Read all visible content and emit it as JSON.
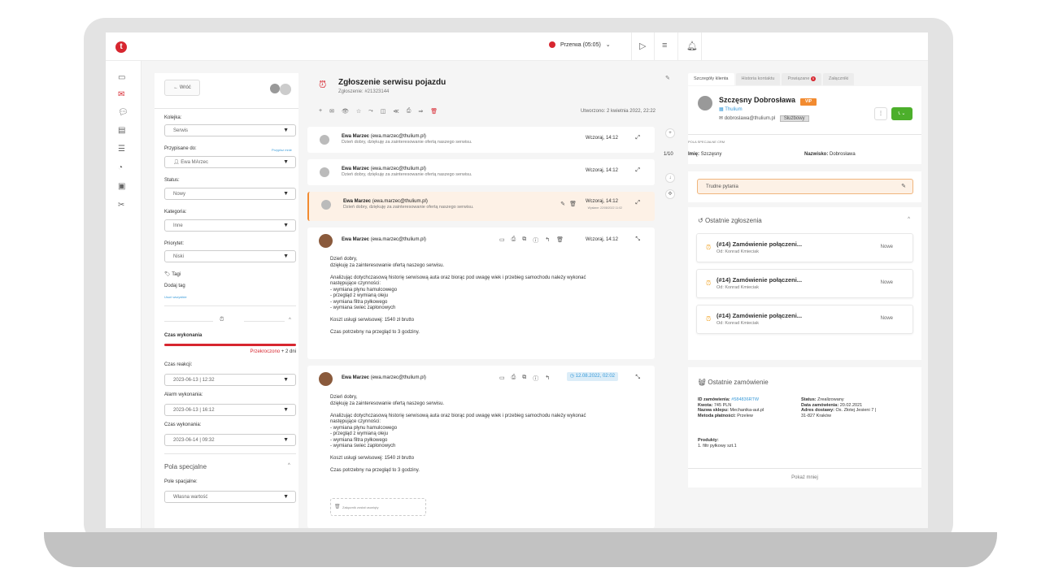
{
  "topbar": {
    "logo": "t",
    "break_label": "Przerwa (05:05)"
  },
  "left": {
    "back_label": "Wróć",
    "queue_label": "Kolejka:",
    "queue_value": "Serwis",
    "assigned_label": "Przypisane do:",
    "assign_me": "Przypisz mnie",
    "assigned_value": "Ewa MArzec",
    "status_label": "Status:",
    "status_value": "Nowy",
    "category_label": "Kategoria:",
    "category_value": "Inne",
    "priority_label": "Priorytet:",
    "priority_value": "Niski",
    "tags_label": "Tagi",
    "add_tag": "Dodaj tag",
    "remove_all": "Usuń wszystkie",
    "exec_time_label": "Czas wykonania",
    "exceeded": "Przekroczono",
    "exceeded_extra": "+ 2 dni",
    "reaction_label": "Czas reakcji:",
    "reaction_value": "2023-06-13 | 12:32",
    "alarm_label": "Alarm wykonania:",
    "alarm_value": "2023-06-13 | 16:12",
    "exec_label": "Czas wykonania:",
    "exec_value": "2023-06-14 | 09:32",
    "special_fields": "Pola specjalne",
    "special_field_label": "Pole spacjalne:",
    "special_field_value": "Własna wartość"
  },
  "center": {
    "title": "Zgłoszenie serwisu pojazdu",
    "subtitle": "Zgłoszenie: #21323144",
    "created": "Utworzono: 2 kwietnia 2022, 22:22",
    "messages": [
      {
        "name": "Ewa Marzec",
        "email": "(ewa.marzec@thulium.pl)",
        "snippet": "Dzień dobry,  dziękuję za zainteresowanie ofertą naszego serwisu.",
        "date": "Wczoraj, 14:12"
      },
      {
        "name": "Ewa Marzec",
        "email": "(ewa.marzec@thulium.pl)",
        "snippet": "Dzień dobry,  dziękuję za zainteresowanie ofertą naszego serwisu.",
        "date": "Wczoraj, 14:12"
      },
      {
        "name": "Ewa Marzec",
        "email": "(ewa.marzec@thulium.pl)",
        "snippet": "Dzień dobry,  dziękuję za zainteresowanie ofertą naszego serwisu.",
        "date": "Wczoraj, 14:12",
        "draft": "Wysłane: 22/08/2022 11:02"
      }
    ],
    "expanded1": {
      "name": "Ewa Marzec",
      "email": "(ewa.marzec@thulium.pl)",
      "date": "Wczoraj, 14:12",
      "body": "Dzień dobry,\ndziękuję za zainteresowanie ofertą naszego serwisu.\n\nAnalizując dotychczasową historię serwisową auta oraz biorąc pod uwagę wiek i przebieg samochodu należy wykonać\nnastępujące czynności:\n- wymiana płynu hamulcowego\n- przegląd z wymianą oleju\n- wymiana filtra pyłkowego\n- wymiana świec zapłonowych\n\nKoszt usługi serwisowej: 1540 zł brutto\n\nCzas potrzebny na przegląd to 3 godziny."
    },
    "expanded2": {
      "name": "Ewa Marzec",
      "email": "(ewa.marzec@thulium.pl)",
      "date": "12.08.2022, 02:02",
      "body": "Dzień dobry,\ndziękuję za zainteresowanie ofertą naszego serwisu.\n\nAnalizując dotychczasową historię serwisową auta oraz biorąc pod uwagę wiek i przebieg samochodu należy wykonać\nnastępujące czynności:\n- wymiana płynu hamulcowego\n- przegląd z wymianą oleju\n- wymiana filtra pyłkowego\n- wymiana świec zapłonowych\n\nKoszt usługi serwisowej: 1540 zł brutto\n\nCzas potrzebny na przegląd to 3 godziny.",
      "attachment": "Załącznik został usunięty"
    },
    "pager": "1/10"
  },
  "right": {
    "tabs": [
      "Szczegóły klienta",
      "Historia kontaktu",
      "Powiązane",
      "Załączniki"
    ],
    "related_count": "5",
    "customer_name": "Szczęsny Dobrosława",
    "vip": "VIP",
    "company": "Thulium",
    "email": "dobroslawa@thulium.pl",
    "email_tag": "Służbowy",
    "crm_header": "POLA SPECJALNE CRM",
    "first_name_label": "Imię:",
    "first_name": "Szczęsny",
    "last_name_label": "Nazwisko:",
    "last_name": "Dobrosława",
    "hard_questions": "Trudne pytania",
    "recent_tickets": "Ostatnie zgłoszenia",
    "tickets": [
      {
        "title": "(#14) Zamówienie połączeni...",
        "from": "Od: Konrad Kmieciak",
        "status": "Nowe"
      },
      {
        "title": "(#14) Zamówienie połączeni...",
        "from": "Od: Konrad Kmieciak",
        "status": "Nowe"
      },
      {
        "title": "(#14) Zamówienie połączeni...",
        "from": "Od: Konrad Kmieciak",
        "status": "Nowe"
      }
    ],
    "recent_orders": "Ostatnie zamówienie",
    "order": {
      "id_label": "ID zamówienia:",
      "id": "#584836RTW",
      "amount_label": "Kwota:",
      "amount": "745 PLN",
      "shop_label": "Nazwa sklepu:",
      "shop": "Mechanika-aut.pl",
      "payment_label": "Metoda płatności:",
      "payment": "Przelew",
      "status_label": "Status:",
      "status": "Zrealizowany",
      "date_label": "Data zamówienia:",
      "date": "20.02.2021",
      "address_label": "Adres dostawy:",
      "address1": "Os. Złotej Jesieni 7 |",
      "address2": "31-827 Kraków",
      "products_label": "Produkty:",
      "products": "1. filtr pyłkowy szt.1"
    },
    "show_less": "Pokaż mniej"
  }
}
